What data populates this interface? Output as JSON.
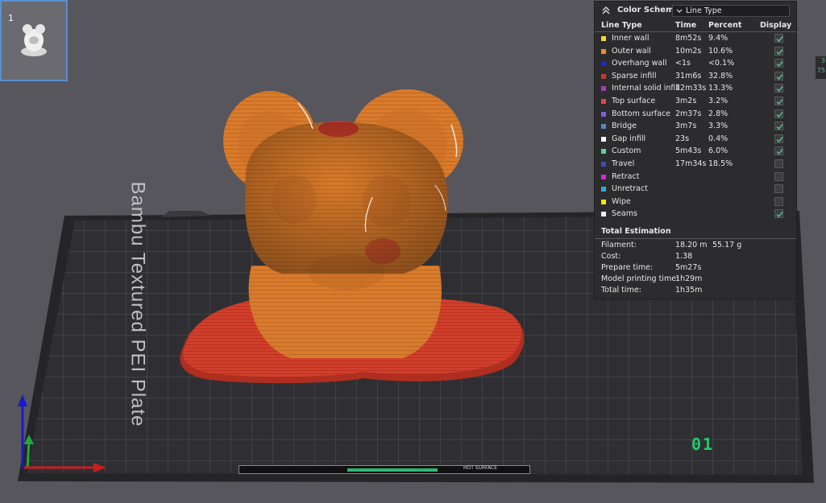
{
  "thumbnail": {
    "plate_number": "1"
  },
  "legend": {
    "title": "Color Scheme",
    "scheme_value": "Line Type",
    "columns": {
      "type": "Line Type",
      "time": "Time",
      "percent": "Percent",
      "display": "Display"
    },
    "rows": [
      {
        "label": "Inner wall",
        "time": "8m52s",
        "percent": "9.4%",
        "color": "#f6d836",
        "display": true
      },
      {
        "label": "Outer wall",
        "time": "10m2s",
        "percent": "10.6%",
        "color": "#f08a2c",
        "display": true
      },
      {
        "label": "Overhang wall",
        "time": "<1s",
        "percent": "<0.1%",
        "color": "#2424e0",
        "display": true
      },
      {
        "label": "Sparse infill",
        "time": "31m6s",
        "percent": "32.8%",
        "color": "#c23b2a",
        "display": true
      },
      {
        "label": "Internal solid infill",
        "time": "12m33s",
        "percent": "13.3%",
        "color": "#a13fc0",
        "display": true
      },
      {
        "label": "Top surface",
        "time": "3m2s",
        "percent": "3.2%",
        "color": "#e8453c",
        "display": true
      },
      {
        "label": "Bottom surface",
        "time": "2m37s",
        "percent": "2.8%",
        "color": "#7b5fd6",
        "display": true
      },
      {
        "label": "Bridge",
        "time": "3m7s",
        "percent": "3.3%",
        "color": "#5b83c4",
        "display": true
      },
      {
        "label": "Gap infill",
        "time": "23s",
        "percent": "0.4%",
        "color": "#ffffff",
        "display": true
      },
      {
        "label": "Custom",
        "time": "5m43s",
        "percent": "6.0%",
        "color": "#5ed19a",
        "display": true
      },
      {
        "label": "Travel",
        "time": "17m34s",
        "percent": "18.5%",
        "color": "#3a4fa8",
        "display": false
      },
      {
        "label": "Retract",
        "time": "",
        "percent": "",
        "color": "#d22fd2",
        "display": false
      },
      {
        "label": "Unretract",
        "time": "",
        "percent": "",
        "color": "#38a8d8",
        "display": false
      },
      {
        "label": "Wipe",
        "time": "",
        "percent": "",
        "color": "#f2e80c",
        "display": false
      },
      {
        "label": "Seams",
        "time": "",
        "percent": "",
        "color": "#f0f0f0",
        "display": true
      }
    ],
    "total_title": "Total Estimation",
    "summary": [
      {
        "label": "Filament:",
        "value": "18.20 m",
        "value2": "55.17 g"
      },
      {
        "label": "Cost:",
        "value": "1.38",
        "value2": ""
      },
      {
        "label": "Prepare time:",
        "value": "5m27s",
        "value2": ""
      },
      {
        "label": "Model printing time:",
        "value": "1h29m",
        "value2": ""
      },
      {
        "label": "Total time:",
        "value": "1h35m",
        "value2": ""
      }
    ]
  },
  "edge_label": {
    "line1": "3",
    "line2": "75"
  },
  "bed": {
    "text": "Bambu Textured PEI Plate",
    "plate_id": "01",
    "sticker_text": "HOT SURFACE"
  },
  "colors": {
    "background": "#56565c",
    "model": "#d77a2a",
    "model_base": "#c83a2a",
    "bed": "#2c2c30",
    "panel": "#2c2c2e",
    "checkbox_check": "#4fc08d"
  }
}
